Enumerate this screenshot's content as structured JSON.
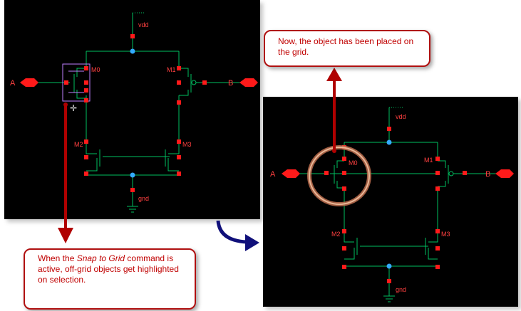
{
  "left_panel": {
    "labels": {
      "vdd": "vdd",
      "a": "A",
      "b": "B",
      "m0": "M0",
      "m1": "M1",
      "m2": "M2",
      "m3": "M3",
      "gnd": "gnd"
    }
  },
  "right_panel": {
    "labels": {
      "vdd": "vdd",
      "a": "A",
      "b": "B",
      "m0": "M0",
      "m1": "M1",
      "m2": "M2",
      "m3": "M3",
      "gnd": "gnd"
    }
  },
  "callout_top": {
    "text": "Now, the object has been placed on the grid."
  },
  "callout_bottom": {
    "prefix": "When the ",
    "emphasis": "Snap to Grid",
    "suffix": " command is active, off-grid objects get highlighted on selection."
  },
  "colors": {
    "background": "#000000",
    "wire": "#00c060",
    "pin": "#ff1a1a",
    "junction": "#33aaff",
    "label": "#ff4040",
    "highlight": "#c080ff",
    "arrow_red": "#b00000",
    "arrow_blue": "#10107a"
  }
}
